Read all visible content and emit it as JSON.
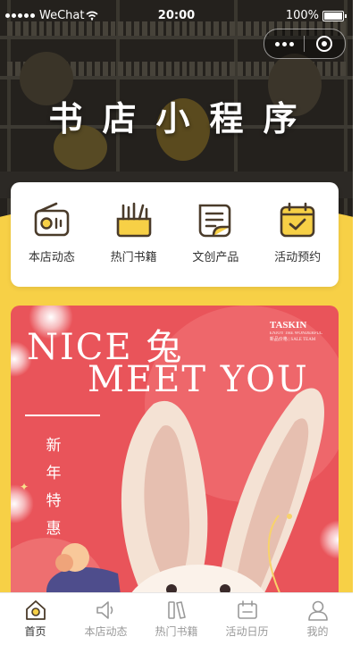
{
  "status_bar": {
    "carrier": "WeChat",
    "time": "20:00",
    "battery": "100%"
  },
  "header": {
    "title": "书店小程序"
  },
  "menu": {
    "items": [
      {
        "label": "本店动态",
        "icon": "radio-icon"
      },
      {
        "label": "热门书籍",
        "icon": "books-icon"
      },
      {
        "label": "文创产品",
        "icon": "document-icon"
      },
      {
        "label": "活动预约",
        "icon": "calendar-check-icon"
      }
    ]
  },
  "banner": {
    "line1": "NICE 兔",
    "line2": "MEET YOU",
    "brand": "TASKIN",
    "brand_sub1": "ENJOY THE WONDERFUL",
    "brand_sub2": "新品价格 | SALE TEAM",
    "vertical_text": "新年特惠"
  },
  "tabbar": {
    "items": [
      {
        "label": "首页",
        "icon": "home-icon",
        "active": true
      },
      {
        "label": "本店动态",
        "icon": "speaker-icon",
        "active": false
      },
      {
        "label": "热门书籍",
        "icon": "books-icon",
        "active": false
      },
      {
        "label": "活动日历",
        "icon": "calendar-icon",
        "active": false
      },
      {
        "label": "我的",
        "icon": "user-icon",
        "active": false
      }
    ]
  },
  "colors": {
    "accent": "#F7D046",
    "icon_stroke": "#4a3b2a",
    "banner_bg": "#E9545A",
    "active_tab": "#333333",
    "inactive_tab": "#999999"
  }
}
